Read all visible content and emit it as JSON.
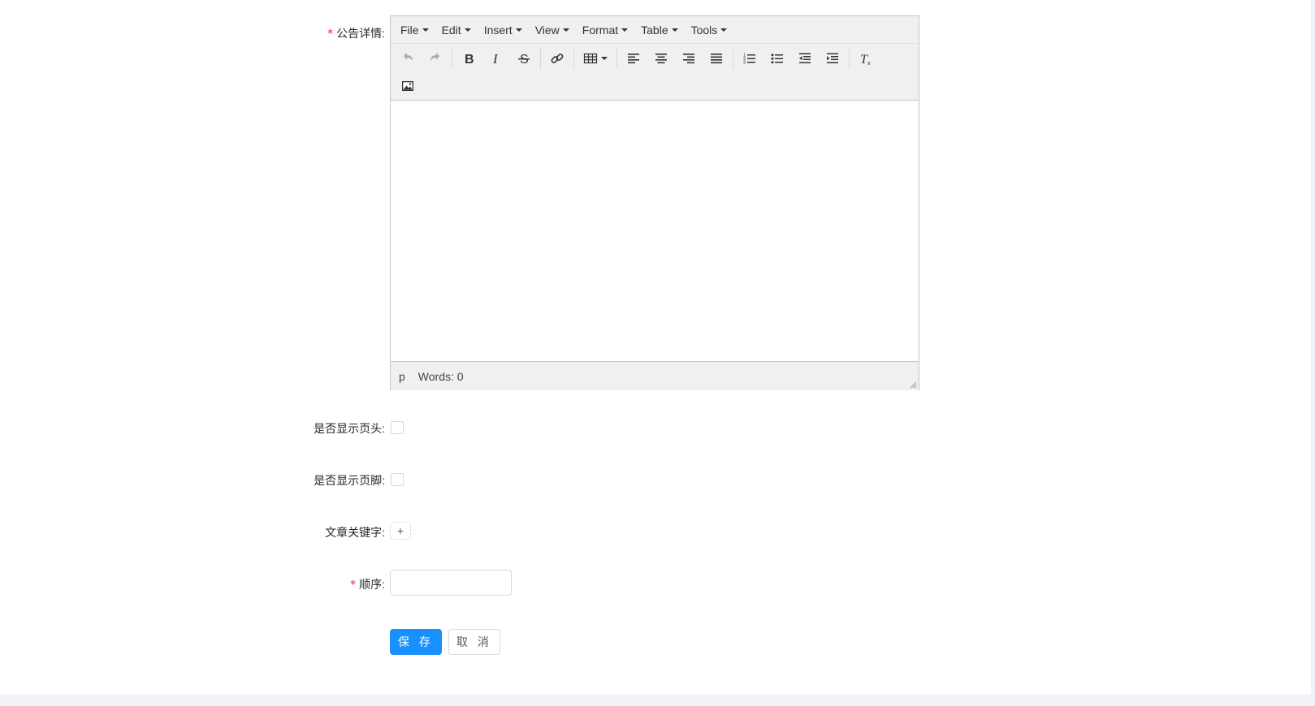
{
  "form": {
    "detail_label": "公告详情",
    "show_header_label": "是否显示页头",
    "show_footer_label": "是否显示页脚",
    "keywords_label": "文章关键字",
    "order_label": "顺序",
    "required_mark": "*",
    "colon": ":",
    "add_tag_symbol": "+",
    "order_value": "",
    "save_label": "保 存",
    "cancel_label": "取 消"
  },
  "editor": {
    "menu": [
      "File",
      "Edit",
      "Insert",
      "View",
      "Format",
      "Table",
      "Tools"
    ],
    "toolbar_icons": [
      "undo-icon",
      "redo-icon",
      "bold-icon",
      "italic-icon",
      "strikethrough-icon",
      "link-icon",
      "table-icon",
      "align-left-icon",
      "align-center-icon",
      "align-right-icon",
      "align-justify-icon",
      "numbered-list-icon",
      "bullet-list-icon",
      "outdent-icon",
      "indent-icon",
      "clear-formatting-icon",
      "image-icon"
    ],
    "status_path": "p",
    "word_count": "Words: 0"
  },
  "colors": {
    "primary": "#1890ff",
    "required": "#f5222d",
    "editor_chrome": "#f0f0f0",
    "page_gutter": "#f0f2f5"
  }
}
